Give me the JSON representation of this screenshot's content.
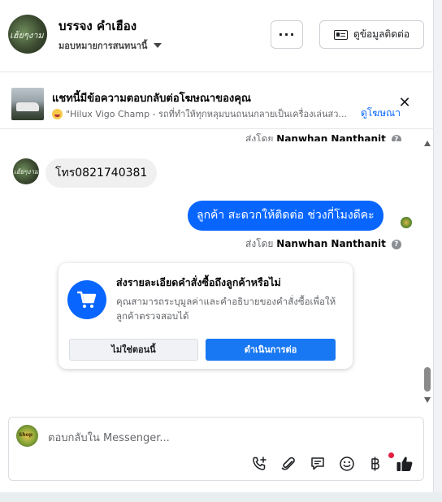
{
  "header": {
    "name": "บรรจง คำเฮือง",
    "subtitle": "มอบหมายการสนทนานี้",
    "avatar_text": "เฮ้ยๆงาม",
    "more_label": "···",
    "contact_label": "ดูข้อมูลติดต่อ"
  },
  "ad_banner": {
    "title": "แชทนี้มีข้อความตอบกลับต่อโฆษณาของคุณ",
    "quote": "\"Hilux Vigo Champ - รถที่ทำให้ทุกหลุมบนถนนกลายเป็นเครื่องเล่นสว...",
    "link": "ดูโฆษณา",
    "close_icon": "close-icon"
  },
  "messages": {
    "sent_by_prefix": "ส่งโดย",
    "sent_by_name": "Nanwhan Nanthanit",
    "incoming_avatar_text": "เฮ้ยๆงาม",
    "incoming": "โทร0821740381",
    "outgoing": "ลูกค้า สะดวกให้ติดต่อ ช่วงกี่โมงดีคะ"
  },
  "order_card": {
    "title": "ส่งรายละเอียดคำสั่งซื้อถึงลูกค้าหรือไม่",
    "description": "คุณสามารถระบุมูลค่าและคำอธิบายของคำสั่งซื้อเพื่อให้ลูกค้าตรวจสอบได้",
    "decline_label": "ไม่ใช่ตอนนี้",
    "accept_label": "ดำเนินการต่อ",
    "icon": "shopping-cart-icon"
  },
  "composer": {
    "placeholder": "ตอบกลับใน Messenger...",
    "avatar_text": "Shop",
    "tools": [
      "phone-add-icon",
      "paperclip-icon",
      "saved-replies-icon",
      "emoji-icon",
      "baht-icon",
      "like-icon"
    ]
  },
  "colors": {
    "accent": "#0866ff",
    "button_blue": "#1877f2",
    "bubble_in": "#f0f0f0",
    "notification": "#e41e3f"
  }
}
